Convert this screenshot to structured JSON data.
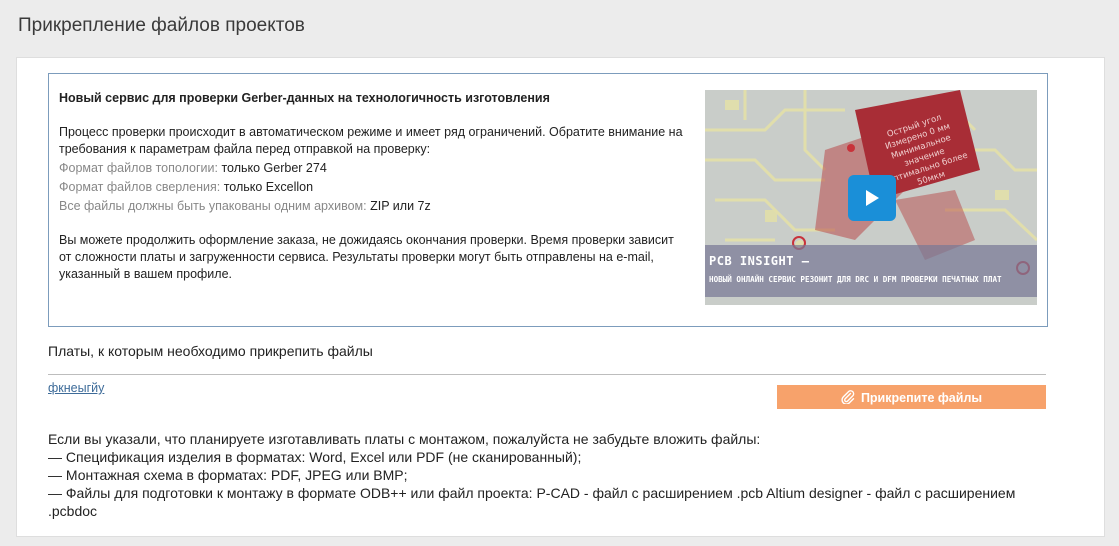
{
  "page": {
    "title": "Прикрепление файлов проектов"
  },
  "info": {
    "heading": "Новый сервис для проверки Gerber-данных на технологичность изготовления",
    "intro": "Процесс проверки происходит в автоматическом режиме и имеет ряд ограничений. Обратите внимание на требования к параметрам файла перед отправкой на проверку:",
    "requirements": [
      {
        "label": "Формат файлов топологии:",
        "value": "только Gerber 274"
      },
      {
        "label": "Формат файлов сверления:",
        "value": "только Excellon"
      },
      {
        "label": "Все файлы должны быть упакованы одним архивом:",
        "value": "ZIP или 7z"
      }
    ],
    "note": "Вы можете продолжить оформление заказа, не дожидаясь окончания проверки. Время проверки зависит от сложности платы и загруженности сервиса. Результаты проверки могут быть отправлены на e-mail, указанный в вашем профиле."
  },
  "video": {
    "banner_title": "PCB INSIGHT –",
    "banner_subtitle": "НОВЫЙ ОНЛАЙН СЕРВИС РЕЗОНИТ ДЛЯ DRC И DFM ПРОВЕРКИ ПЕЧАТНЫХ ПЛАТ",
    "note_lines": [
      "Острый угол",
      "Измерено 0 мм",
      "Минимальное значение",
      "оптимально более",
      "50мкм"
    ],
    "play_icon": "play-icon"
  },
  "boards": {
    "label": "Платы, к которым необходимо прикрепить файлы",
    "items": [
      {
        "name": "фкнеыгйу"
      }
    ],
    "attach_label": "Прикрепите файлы",
    "attach_icon": "paperclip-icon",
    "attach_color": "#f7a26b"
  },
  "montage": {
    "lines": [
      "Если вы указали, что планируете изготавливать платы с монтажом, пожалуйста не забудьте вложить файлы:",
      "— Спецификация изделия в форматах: Word, Excel или PDF (не сканированный);",
      "— Монтажная схема в форматах: PDF, JPEG или BMP;",
      "— Файлы для подготовки к монтажу в формате ODB++ или файл проекта: P-CAD - файл с расширением .pcb Altium designer - файл с расширением .pcbdoc"
    ]
  }
}
